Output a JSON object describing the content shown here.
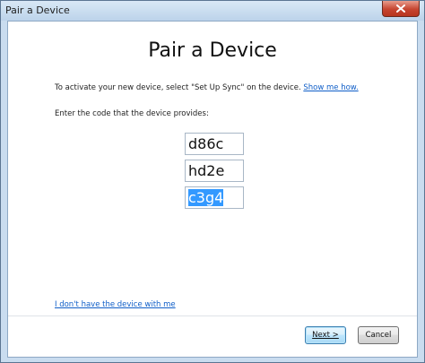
{
  "window": {
    "title": "Pair a Device"
  },
  "content": {
    "heading": "Pair a Device",
    "intro_text": "To activate your new device, select \"Set Up Sync\" on the device. ",
    "intro_link": "Show me how.",
    "code_instruction": "Enter the code that the device provides:",
    "code_fields": [
      "d86c",
      "hd2e",
      "c3g4"
    ],
    "no_device_link": "I don't have the device with me"
  },
  "buttons": {
    "next_label": "Next >",
    "cancel_label": "Cancel"
  },
  "colors": {
    "selection": "#3399ff",
    "link": "#0f5ec8",
    "close_button": "#c64530"
  }
}
